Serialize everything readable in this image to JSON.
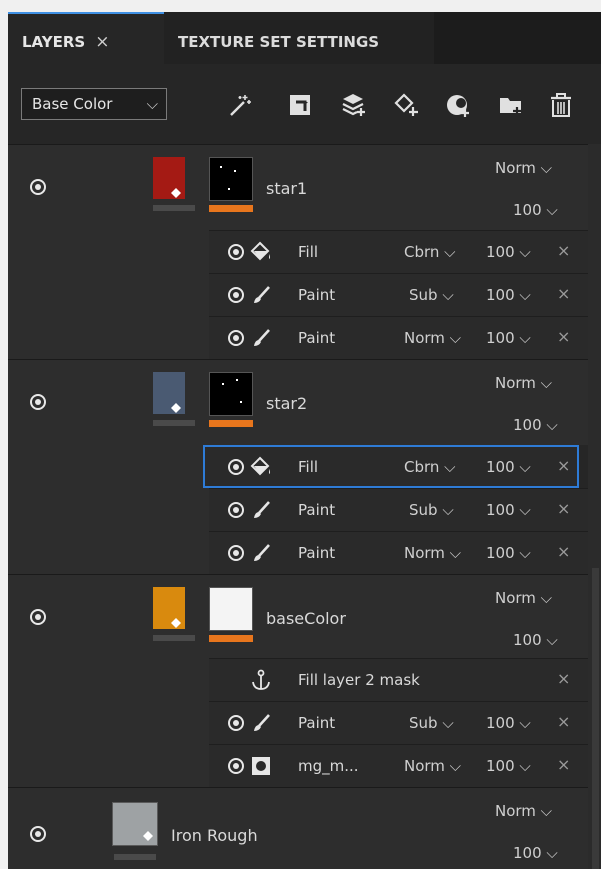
{
  "tabs": {
    "layers": "LAYERS",
    "layers_close": "×",
    "texture_set_settings": "TEXTURE SET SETTINGS"
  },
  "toolbar": {
    "channel": "Base Color",
    "chevron": "⌵",
    "icons": [
      "magic-wand-icon",
      "add-fill-layer-icon",
      "add-layer-icon",
      "add-paint-layer-icon",
      "add-effect-icon",
      "add-folder-icon",
      "delete-icon"
    ]
  },
  "layers": [
    {
      "name": "star1",
      "blend": "Norm ⌵",
      "opacity": "100 ⌵",
      "color": "#a41a14",
      "effects": [
        {
          "type": "fill",
          "name": "Fill",
          "blend": "Cbrn ⌵",
          "opacity": "100 ⌵",
          "close": "×"
        },
        {
          "type": "paint",
          "name": "Paint",
          "blend": "Sub ⌵",
          "opacity": "100 ⌵",
          "close": "×"
        },
        {
          "type": "paint",
          "name": "Paint",
          "blend": "Norm ⌵",
          "opacity": "100 ⌵",
          "close": "×"
        }
      ]
    },
    {
      "name": "star2",
      "blend": "Norm ⌵",
      "opacity": "100 ⌵",
      "color": "#4a5a72",
      "effects": [
        {
          "type": "fill",
          "name": "Fill",
          "blend": "Cbrn ⌵",
          "opacity": "100 ⌵",
          "close": "×",
          "selected": true
        },
        {
          "type": "paint",
          "name": "Paint",
          "blend": "Sub ⌵",
          "opacity": "100 ⌵",
          "close": "×"
        },
        {
          "type": "paint",
          "name": "Paint",
          "blend": "Norm ⌵",
          "opacity": "100 ⌵",
          "close": "×"
        }
      ]
    },
    {
      "name": "baseColor",
      "blend": "Norm ⌵",
      "opacity": "100 ⌵",
      "color": "#d98a0e",
      "effects": [
        {
          "type": "anchor",
          "name": "Fill layer 2 mask",
          "close": "×"
        },
        {
          "type": "paint",
          "name": "Paint",
          "blend": "Sub ⌵",
          "opacity": "100 ⌵",
          "close": "×"
        },
        {
          "type": "filter",
          "name": "mg_m...",
          "blend": "Norm ⌵",
          "opacity": "100 ⌵",
          "close": "×"
        }
      ]
    },
    {
      "name": "Iron Rough",
      "blend": "Norm ⌵",
      "opacity": "100 ⌵",
      "color": "#9ea2a4"
    }
  ]
}
